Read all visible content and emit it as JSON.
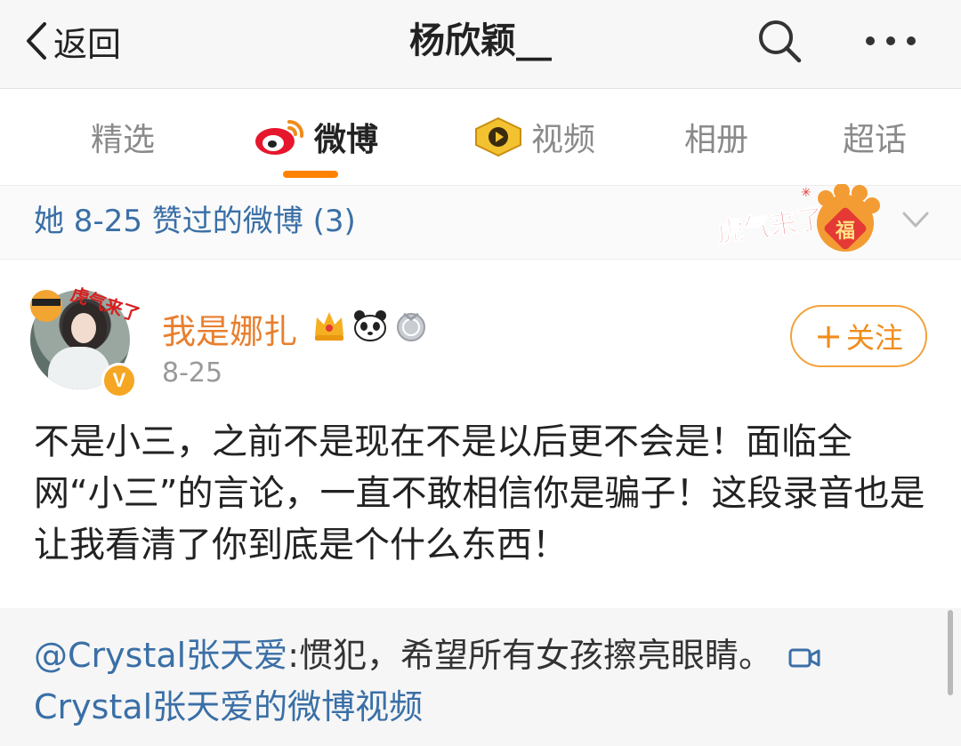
{
  "nav": {
    "back_label": "返回",
    "title": "杨欣颖__",
    "search_icon": "search-icon",
    "more_icon": "more-dots-icon"
  },
  "tabs": [
    {
      "label": "精选",
      "active": false
    },
    {
      "label": "微博",
      "active": true,
      "icon": "weibo-logo-icon"
    },
    {
      "label": "视频",
      "active": false,
      "icon": "video-play-badge-icon"
    },
    {
      "label": "相册",
      "active": false
    },
    {
      "label": "超话",
      "active": false
    }
  ],
  "liked_header": {
    "text": "她 8-25 赞过的微博 (3)",
    "sticker_text": "虎气来了",
    "sticker_char": "福"
  },
  "post": {
    "username": "我是娜扎",
    "date": "8-25",
    "follow_label": "关注",
    "avatar_sticker_text": "虎气来了",
    "badge_icons": [
      "crown-badge-icon",
      "panda-badge-icon",
      "medal-badge-icon"
    ],
    "body": "不是小三，之前不是现在不是以后更不会是！面临全网“小三”的言论，一直不敢相信你是骗子！这段录音也是让我看清了你到底是个什么东西！"
  },
  "repost": {
    "user": "@Crystal张天爱",
    "text": ":惯犯，希望所有女孩擦亮眼睛。",
    "video_link": "Crystal张天爱的微博视频"
  },
  "colors": {
    "accent": "#ff8200",
    "link": "#3a6fa6",
    "username": "#e87f2e"
  }
}
